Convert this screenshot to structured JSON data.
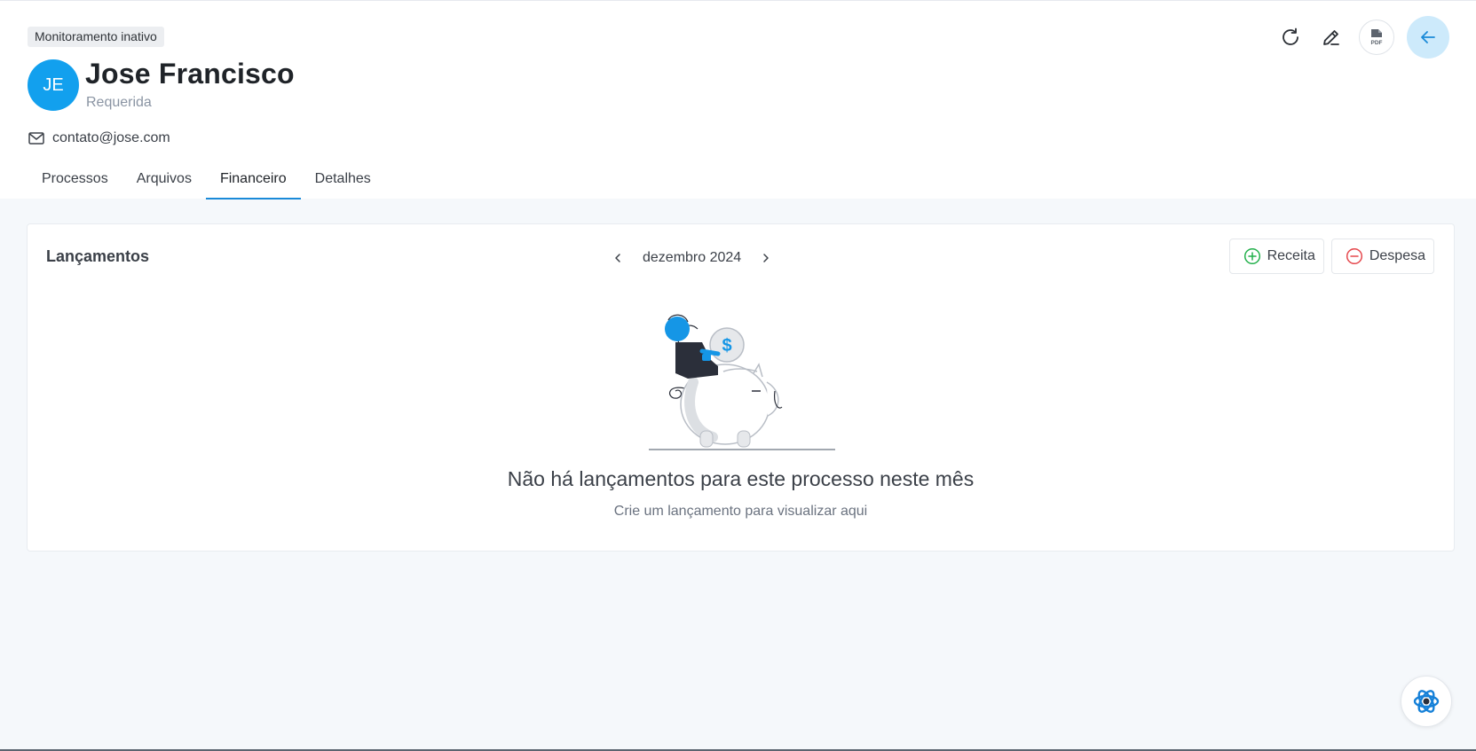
{
  "header": {
    "status_badge": "Monitoramento inativo",
    "avatar_initials": "JE",
    "name": "Jose Francisco",
    "role": "Requerida",
    "email": "contato@jose.com",
    "pdf_label": "PDF"
  },
  "tabs": [
    {
      "label": "Processos",
      "active": false
    },
    {
      "label": "Arquivos",
      "active": false
    },
    {
      "label": "Financeiro",
      "active": true
    },
    {
      "label": "Detalhes",
      "active": false
    }
  ],
  "card": {
    "title": "Lançamentos",
    "month": "dezembro 2024",
    "income_label": "Receita",
    "expense_label": "Despesa",
    "empty_title": "Não há lançamentos para este processo neste mês",
    "empty_subtitle": "Crie um lançamento para visualizar aqui",
    "illustration_symbol": "$"
  },
  "colors": {
    "accent": "#12a0ee",
    "tab_underline": "#1a8ad8",
    "income": "#22b04b",
    "expense": "#e5484d",
    "back_button_bg": "#cdeafb"
  },
  "icons": {
    "refresh": "refresh-icon",
    "edit": "edit-icon",
    "pdf": "pdf-icon",
    "back": "arrow-left-icon",
    "email": "mail-icon",
    "prev": "chevron-left-icon",
    "next": "chevron-right-icon",
    "income": "plus-circle-icon",
    "expense": "minus-circle-icon",
    "assistant": "assistant-icon"
  }
}
